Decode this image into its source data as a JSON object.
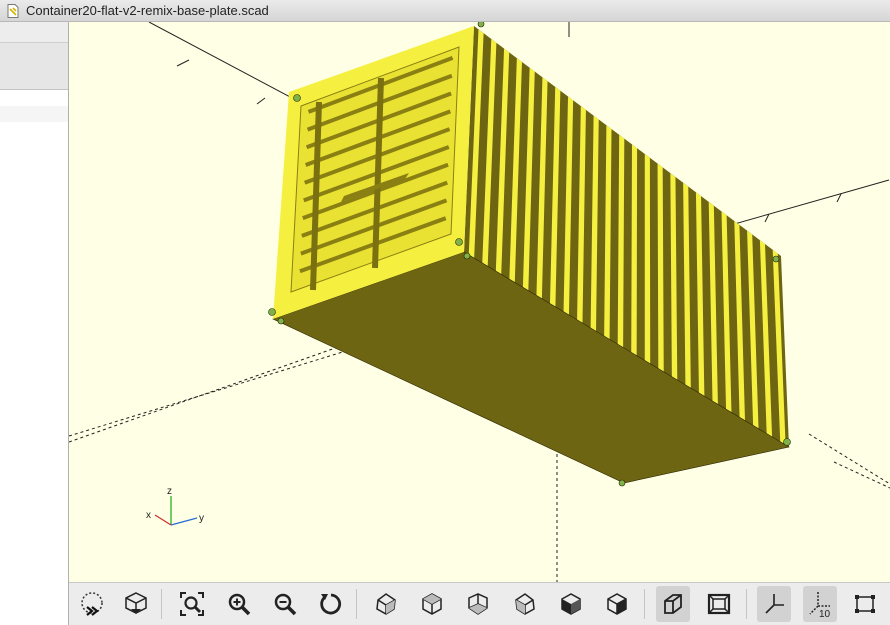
{
  "window": {
    "title": "Container20-flat-v2-remix-base-plate.scad"
  },
  "viewport": {
    "background": "#ffffe5",
    "model_colors": {
      "face_light": "#f5f040",
      "face_mid": "#cfc828",
      "face_dark": "#6e6512",
      "outline": "#2b2603"
    },
    "axes_indicator": {
      "x_label": "x",
      "y_label": "y",
      "z_label": "z"
    }
  },
  "toolbar": {
    "buttons": [
      {
        "name": "preview-button",
        "icon": "preview-render-icon"
      },
      {
        "name": "render-button",
        "icon": "render-icon"
      },
      {
        "name": "view-all-button",
        "icon": "zoom-fit-icon"
      },
      {
        "name": "zoom-in-button",
        "icon": "zoom-in-icon"
      },
      {
        "name": "zoom-out-button",
        "icon": "zoom-out-icon"
      },
      {
        "name": "reset-view-button",
        "icon": "reset-view-icon"
      },
      {
        "name": "view-right-button",
        "icon": "view-right-icon"
      },
      {
        "name": "view-top-button",
        "icon": "view-top-icon"
      },
      {
        "name": "view-bottom-button",
        "icon": "view-bottom-icon"
      },
      {
        "name": "view-left-button",
        "icon": "view-left-icon"
      },
      {
        "name": "view-front-button",
        "icon": "view-front-icon"
      },
      {
        "name": "view-back-button",
        "icon": "view-back-icon"
      },
      {
        "name": "perspective-button",
        "icon": "perspective-icon"
      },
      {
        "name": "orthogonal-button",
        "icon": "orthogonal-icon"
      },
      {
        "name": "show-axes-button",
        "icon": "axes-icon"
      },
      {
        "name": "show-scale-markers-button",
        "icon": "scale-markers-icon",
        "text": "10"
      },
      {
        "name": "show-edges-button",
        "icon": "edges-icon"
      }
    ]
  }
}
